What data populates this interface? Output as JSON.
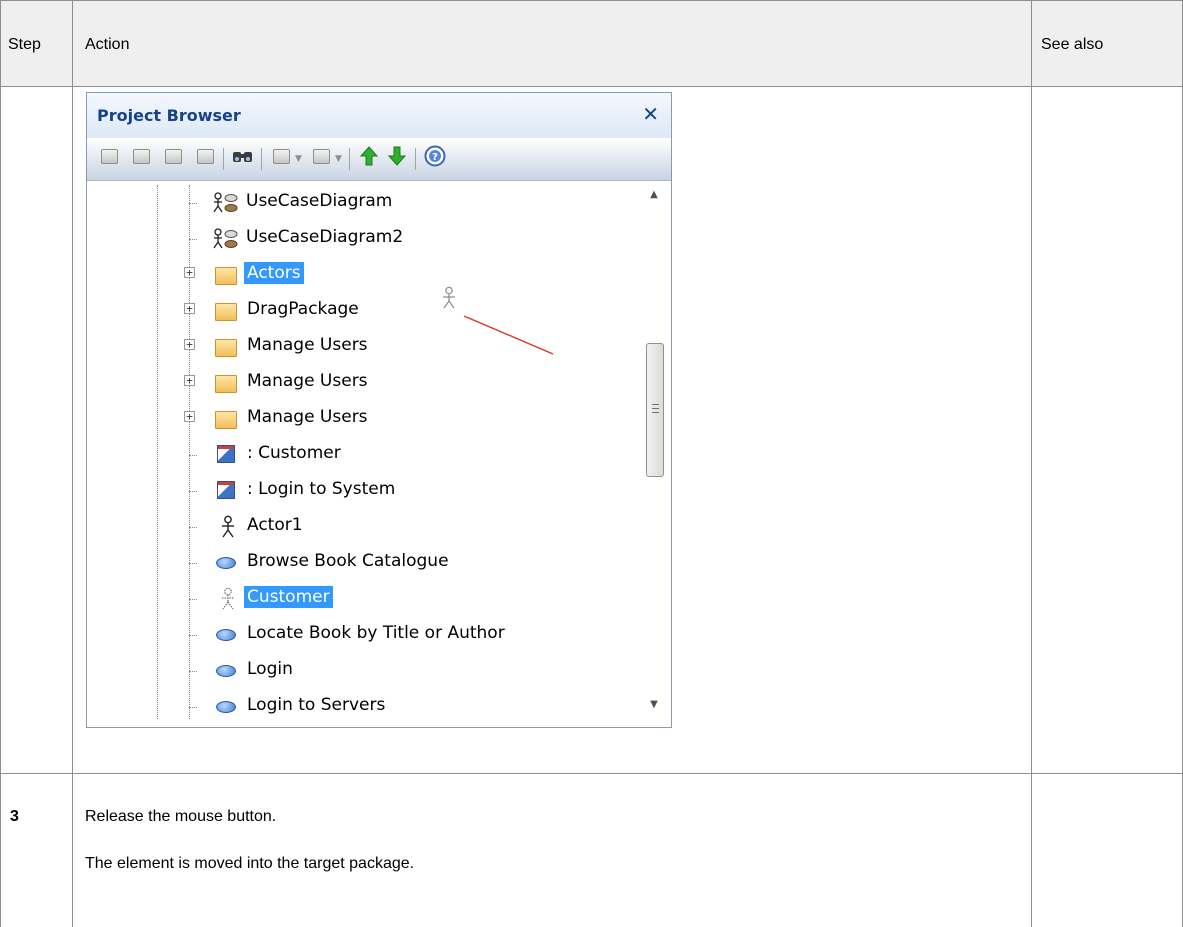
{
  "table": {
    "header": {
      "step": "Step",
      "action": "Action",
      "see_also": "See also"
    },
    "row3": {
      "step": "3",
      "lines": [
        "Release the mouse button.",
        "The element is moved into the target package."
      ]
    }
  },
  "project_browser": {
    "title": "Project Browser",
    "close": "✕",
    "tree": [
      {
        "label": "UseCaseDiagram",
        "icon": "usecase-diagram-icon"
      },
      {
        "label": "UseCaseDiagram2",
        "icon": "usecase-diagram-icon"
      },
      {
        "label": "Actors",
        "icon": "folder-icon",
        "selected": true
      },
      {
        "label": "DragPackage",
        "icon": "folder-icon"
      },
      {
        "label": "Manage Users",
        "icon": "folder-icon"
      },
      {
        "label": "Manage Users",
        "icon": "folder-icon"
      },
      {
        "label": "Manage Users",
        "icon": "folder-icon"
      },
      {
        "label": ": Customer",
        "icon": "object-instance-icon"
      },
      {
        "label": ": Login to System",
        "icon": "object-instance-icon"
      },
      {
        "label": "Actor1",
        "icon": "actor-icon"
      },
      {
        "label": "Browse Book Catalogue",
        "icon": "usecase-icon"
      },
      {
        "label": "Customer",
        "icon": "actor-icon",
        "selected": true
      },
      {
        "label": "Locate Book by Title or Author",
        "icon": "usecase-icon"
      },
      {
        "label": "Login",
        "icon": "usecase-icon"
      },
      {
        "label": "Login to Servers",
        "icon": "usecase-icon"
      }
    ]
  },
  "colors": {
    "selection": "#3399ff",
    "title_text": "#15428b",
    "drag_line": "#e0302a"
  }
}
